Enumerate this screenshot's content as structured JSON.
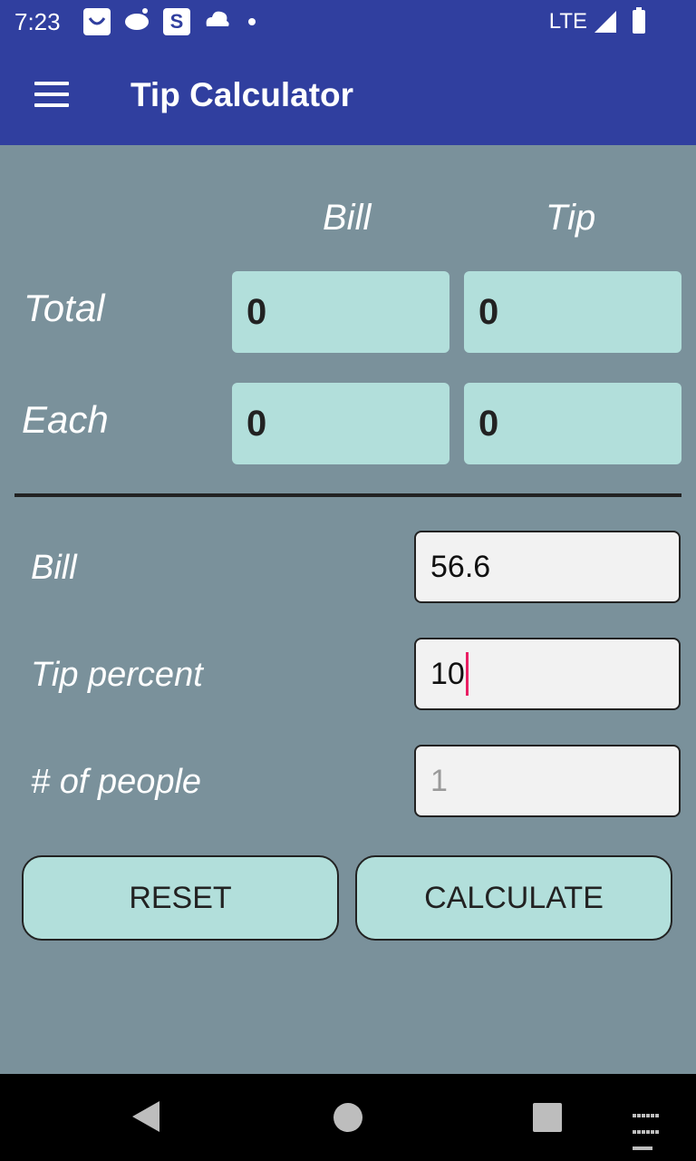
{
  "status_bar": {
    "time": "7:23",
    "network": "LTE",
    "s_badge": "S",
    "icons": [
      "shopping-bag-icon",
      "reddit-icon",
      "s-app-icon",
      "cloud-app-icon",
      "dot-icon",
      "signal-icon",
      "battery-icon"
    ]
  },
  "app_bar": {
    "title": "Tip Calculator",
    "menu_icon": "menu-icon"
  },
  "results": {
    "headers": {
      "bill": "Bill",
      "tip": "Tip"
    },
    "total": {
      "label": "Total",
      "bill": "0",
      "tip": "0"
    },
    "each": {
      "label": "Each",
      "bill": "0",
      "tip": "0"
    }
  },
  "inputs": {
    "bill": {
      "label": "Bill",
      "value": "56.6"
    },
    "tip_percent": {
      "label": "Tip percent",
      "value": "10"
    },
    "people": {
      "label": "# of people",
      "placeholder": "1"
    }
  },
  "buttons": {
    "reset": "RESET",
    "calculate": "CALCULATE"
  },
  "colors": {
    "primary": "#303f9f",
    "background": "#7a919b",
    "accent_box": "#b2dfdb",
    "cursor": "#e91e63"
  }
}
